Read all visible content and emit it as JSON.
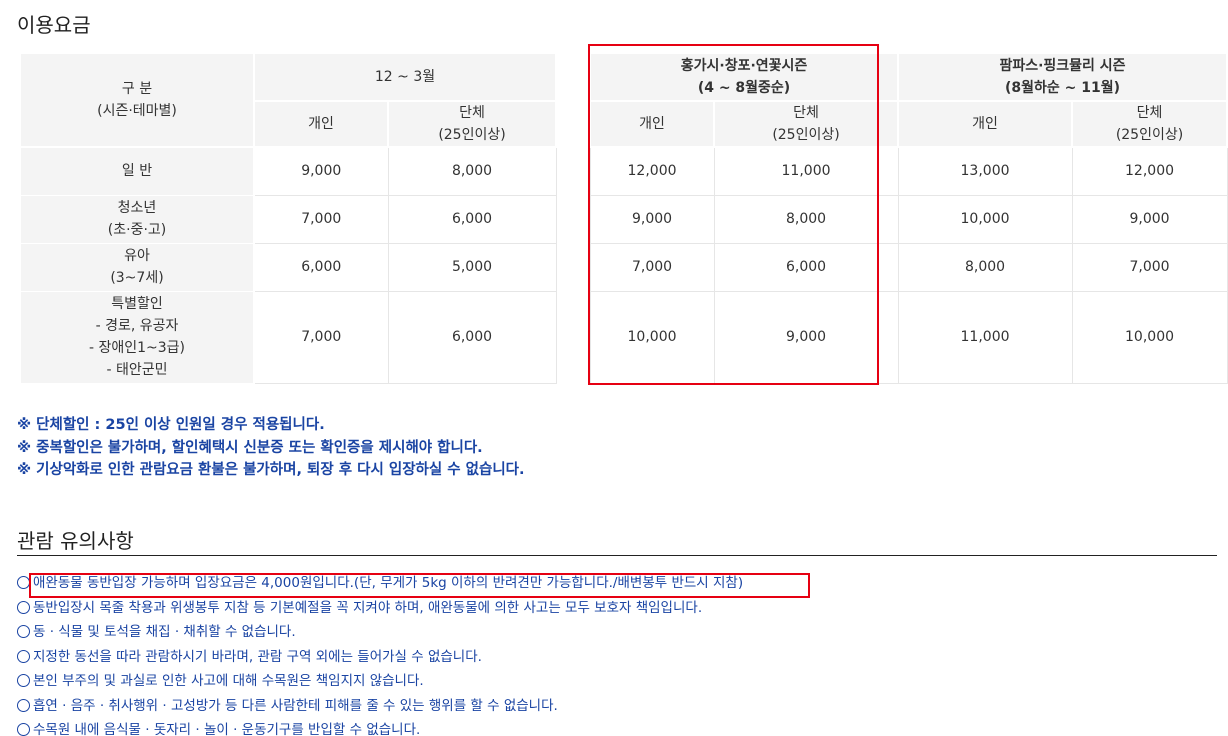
{
  "fees": {
    "title": "이용요금",
    "header": {
      "category": [
        "구 분",
        "(시즌·테마별)"
      ],
      "seasons": [
        [
          "12 ~ 3월"
        ],
        [
          "홍가시·창포·연꽃시즌",
          "(4 ~ 8월중순)"
        ],
        [
          "팜파스·핑크뮬리 시즌",
          "(8월하순 ~ 11월)"
        ]
      ],
      "individual": "개인",
      "group": [
        "단체",
        "(25인이상)"
      ]
    },
    "rows": [
      {
        "label": [
          "일 반"
        ],
        "values": [
          "9,000",
          "8,000",
          "12,000",
          "11,000",
          "13,000",
          "12,000"
        ]
      },
      {
        "label": [
          "청소년",
          "(초·중·고)"
        ],
        "values": [
          "7,000",
          "6,000",
          "9,000",
          "8,000",
          "10,000",
          "9,000"
        ]
      },
      {
        "label": [
          "유아",
          "(3~7세)"
        ],
        "values": [
          "6,000",
          "5,000",
          "7,000",
          "6,000",
          "8,000",
          "7,000"
        ]
      },
      {
        "label": [
          "특별할인",
          "- 경로, 유공자",
          "- 장애인1~3급)",
          "- 태안군민"
        ],
        "values": [
          "7,000",
          "6,000",
          "10,000",
          "9,000",
          "11,000",
          "10,000"
        ]
      }
    ]
  },
  "notices": [
    "※ 단체할인 : 25인 이상 인원일 경우 적용됩니다.",
    "※ 중복할인은 불가하며, 할인혜택시 신분증 또는 확인증을 제시해야 합니다.",
    "※ 기상악화로 인한 관람요금 환불은 불가하며, 퇴장 후 다시 입장하실 수 없습니다."
  ],
  "notes": {
    "title": "관람 유의사항",
    "items": [
      "애완동물 동반입장 가능하며 입장요금은 4,000원입니다.(단, 무게가 5kg 이하의 반려견만 가능합니다./배변봉투 반드시 지참)",
      "동반입장시 목줄 착용과 위생봉투 지참 등 기본예절을 꼭 지켜야 하며, 애완동물에 의한 사고는 모두 보호자 책임입니다.",
      "동 · 식물 및 토석을 채집 · 채취할 수 없습니다.",
      "지정한 동선을 따라 관람하시기 바라며, 관람 구역 외에는 들어가실 수 없습니다.",
      "본인 부주의 및 과실로 인한 사고에 대해 수목원은 책임지지 않습니다.",
      "흡연 · 음주 · 취사행위 · 고성방가 등 다른 사람한테 피해를 줄 수 있는 행위를 할 수 없습니다.",
      "수목원 내에 음식물 · 돗자리 · 놀이 · 운동기구를 반입할 수 없습니다."
    ]
  },
  "colors": {
    "highlight": "#e60012",
    "notice_text": "#1a44a3",
    "header_bg": "#f4f4f4"
  }
}
